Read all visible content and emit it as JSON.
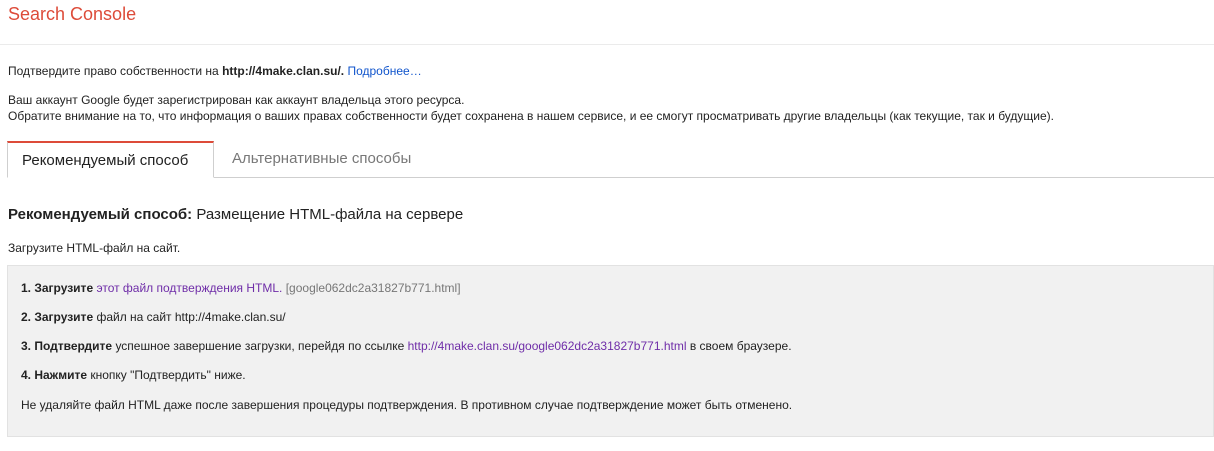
{
  "app": {
    "title": "Search Console"
  },
  "intro": {
    "prefix": "Подтвердите право собственности на ",
    "domain": "http://4make.clan.su/.",
    "more_link": "Подробнее…"
  },
  "account": {
    "line1": "Ваш аккаунт Google будет зарегистрирован как аккаунт владельца этого ресурса.",
    "line2": "Обратите внимание на то, что информация о ваших правах собственности будет сохранена в нашем сервисе, и ее смогут просматривать другие владельцы (как текущие, так и будущие)."
  },
  "tabs": [
    {
      "label": "Рекомендуемый способ",
      "active": true
    },
    {
      "label": "Альтернативные способы",
      "active": false
    }
  ],
  "method": {
    "label": "Рекомендуемый способ:",
    "value": " Размещение HTML-файла на сервере"
  },
  "upload_hint": "Загрузите HTML-файл на сайт.",
  "steps": {
    "s1_bold": "1. Загрузите",
    "s1_link": "этот файл подтверждения HTML.",
    "s1_file": "[google062dc2a31827b771.html]",
    "s2_bold": "2. Загрузите",
    "s2_text": " файл на сайт http://4make.clan.su/",
    "s3_bold": "3. Подтвердите",
    "s3_text": " успешное завершение загрузки, перейдя по ссылке ",
    "s3_link": "http://4make.clan.su/google062dc2a31827b771.html",
    "s3_suffix": " в своем браузере.",
    "s4_bold": "4. Нажмите",
    "s4_text": " кнопку \"Подтвердить\" ниже.",
    "note": "Не удаляйте файл HTML даже после завершения процедуры подтверждения. В противном случае подтверждение может быть отменено."
  },
  "colors": {
    "brand": "#dd4b39",
    "link": "#1155cc",
    "visited_link": "#6f2da8",
    "box_bg": "#f1f1f1"
  }
}
